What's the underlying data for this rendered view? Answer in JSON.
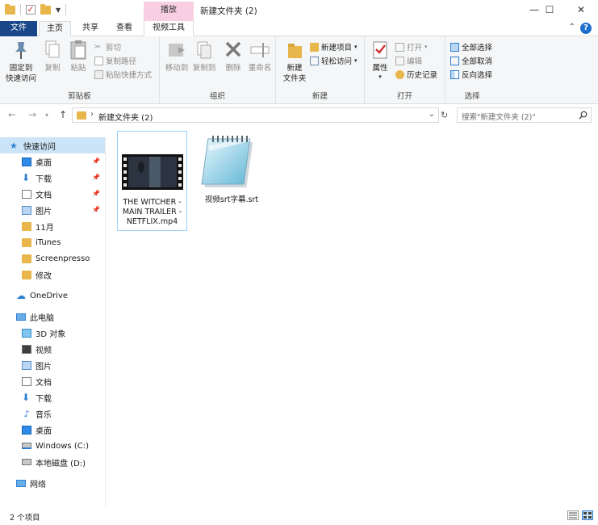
{
  "window": {
    "title": "新建文件夹 (2)",
    "context_group": "播放",
    "minimize": "—",
    "maximize": "☐",
    "close": "✕"
  },
  "tabs": {
    "file": "文件",
    "home": "主页",
    "share": "共享",
    "view": "查看",
    "video_tools": "视频工具"
  },
  "ribbon": {
    "clipboard": {
      "label": "剪贴板",
      "pin_quick": "固定到\n快速访问",
      "copy": "复制",
      "paste": "粘贴",
      "cut": "剪切",
      "copy_path": "复制路径",
      "paste_shortcut": "粘贴快捷方式"
    },
    "organize": {
      "label": "组织",
      "move_to": "移动到",
      "copy_to": "复制到",
      "delete": "删除",
      "rename": "重命名"
    },
    "new": {
      "label": "新建",
      "new_folder": "新建\n文件夹",
      "new_item": "新建项目",
      "easy_access": "轻松访问"
    },
    "open": {
      "label": "打开",
      "properties": "属性",
      "open": "打开",
      "edit": "编辑",
      "history": "历史记录"
    },
    "select": {
      "label": "选择",
      "select_all": "全部选择",
      "select_none": "全部取消",
      "invert": "反向选择"
    }
  },
  "address": {
    "path": "新建文件夹 (2)",
    "search_placeholder": "搜索\"新建文件夹 (2)\""
  },
  "nav": {
    "quick_access": "快速访问",
    "qa_items": [
      "桌面",
      "下载",
      "文档",
      "图片",
      "11月",
      "iTunes",
      "Screenpresso",
      "修改"
    ],
    "onedrive": "OneDrive",
    "this_pc": "此电脑",
    "pc_items": [
      "3D 对象",
      "视频",
      "图片",
      "文档",
      "下载",
      "音乐",
      "桌面",
      "Windows (C:)",
      "本地磁盘 (D:)"
    ],
    "network": "网络"
  },
  "files": [
    {
      "name": "THE WITCHER - MAIN TRAILER - NETFLIX.mp4",
      "icon": "video-thumbnail-icon"
    },
    {
      "name": "视频srt字幕.srt",
      "icon": "notepad-icon"
    }
  ],
  "status": {
    "count": "2 个项目"
  },
  "colors": {
    "file_tab": "#19478a",
    "context_tab": "#f8cfe2",
    "selection": "#cce4f7",
    "folder": "#e8b64a"
  }
}
